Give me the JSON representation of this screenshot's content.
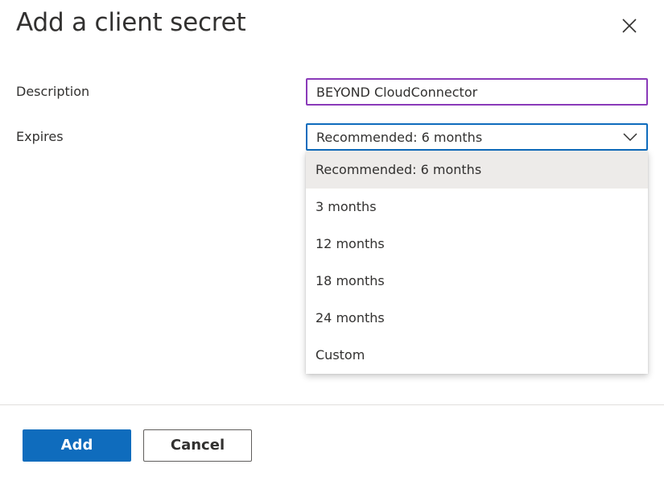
{
  "dialog": {
    "title": "Add a client secret"
  },
  "form": {
    "description_label": "Description",
    "description_value": "BEYOND CloudConnector",
    "expires_label": "Expires",
    "expires_selected": "Recommended: 6 months",
    "expires_options": [
      "Recommended: 6 months",
      "3 months",
      "12 months",
      "18 months",
      "24 months",
      "Custom"
    ]
  },
  "footer": {
    "add_label": "Add",
    "cancel_label": "Cancel"
  },
  "colors": {
    "primary": "#0f6cbd",
    "description_border": "#8a3ab9",
    "selected_option_bg": "#edebe9"
  },
  "icons": {
    "close": "close-icon",
    "dropdown": "chevron-down-icon"
  }
}
